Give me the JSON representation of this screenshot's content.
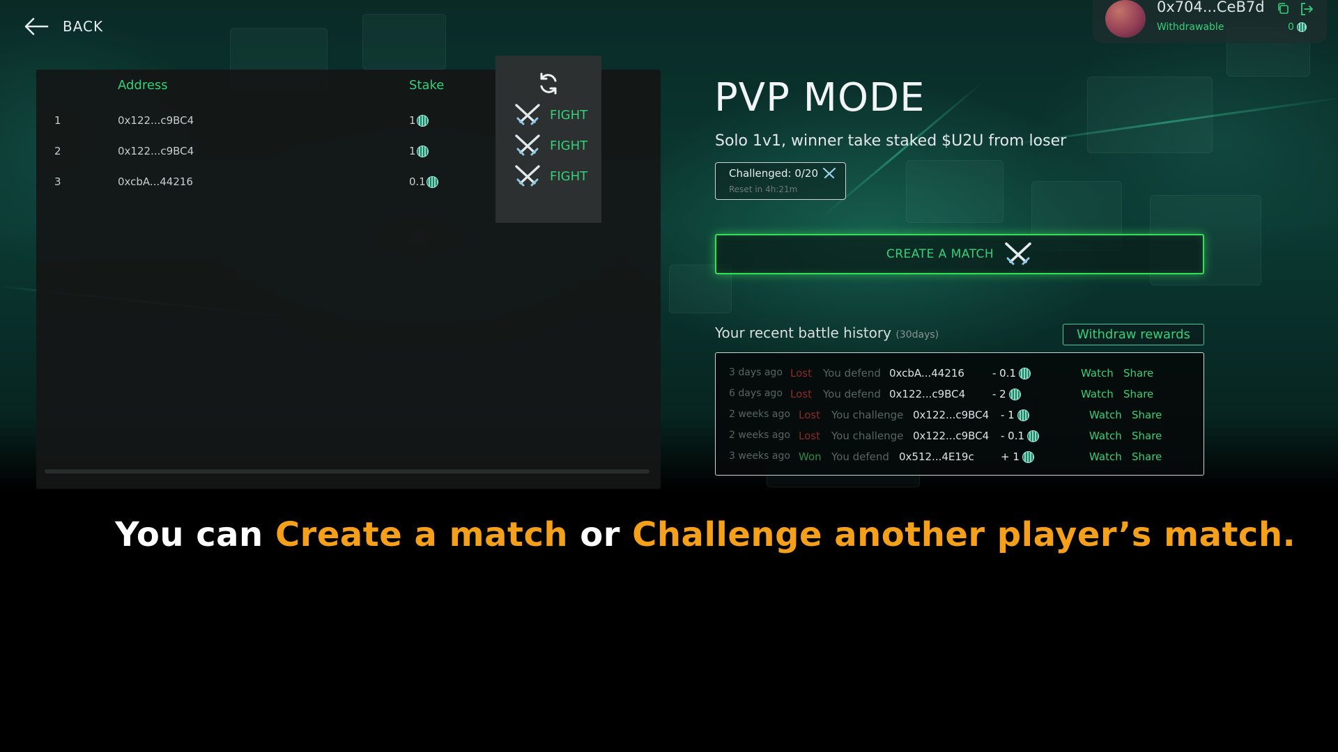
{
  "top": {
    "back_label": "BACK"
  },
  "wallet": {
    "address": "0x704...CeB7d",
    "withdrawable_label": "Withdrawable",
    "withdrawable_value": "0"
  },
  "matches": {
    "columns": {
      "address": "Address",
      "stake": "Stake"
    },
    "fight_label": "FIGHT",
    "rows": [
      {
        "index": "1",
        "address": "0x122...c9BC4",
        "stake": "1"
      },
      {
        "index": "2",
        "address": "0x122...c9BC4",
        "stake": "1"
      },
      {
        "index": "3",
        "address": "0xcbA...44216",
        "stake": "0.1"
      }
    ]
  },
  "mode": {
    "title": "PVP MODE",
    "subtitle": "Solo 1v1, winner take staked $U2U from loser",
    "challenged": "Challenged: 0/20",
    "reset": "Reset in 4h:21m",
    "create_label": "CREATE A MATCH"
  },
  "history": {
    "title": "Your recent battle history",
    "period": "(30days)",
    "withdraw_label": "Withdraw rewards",
    "watch_label": "Watch",
    "share_label": "Share",
    "rows": [
      {
        "time": "3 days ago",
        "result": "Lost",
        "action": "You defend",
        "opponent": "0xcbA...44216",
        "amount": "- 0.1"
      },
      {
        "time": "6 days ago",
        "result": "Lost",
        "action": "You defend",
        "opponent": "0x122...c9BC4",
        "amount": "- 2"
      },
      {
        "time": "2 weeks ago",
        "result": "Lost",
        "action": "You challenge",
        "opponent": "0x122...c9BC4",
        "amount": "- 1"
      },
      {
        "time": "2 weeks ago",
        "result": "Lost",
        "action": "You challenge",
        "opponent": "0x122...c9BC4",
        "amount": "- 0.1"
      },
      {
        "time": "3 weeks ago",
        "result": "Won",
        "action": "You defend",
        "opponent": "0x512...4E19c",
        "amount": "+ 1"
      }
    ]
  },
  "caption": {
    "part1": "You can ",
    "highlight1": "Create a match",
    "part2": " or ",
    "highlight2": "Challenge another player’s match."
  },
  "colors": {
    "accent_green": "#35d07a",
    "highlight_orange": "#f5a01a",
    "lost_red": "#8a2b2b"
  },
  "icons": [
    "back-arrow-icon",
    "copy-icon",
    "logout-icon",
    "refresh-icon",
    "crossed-swords-icon",
    "close-icon",
    "coin-icon"
  ]
}
